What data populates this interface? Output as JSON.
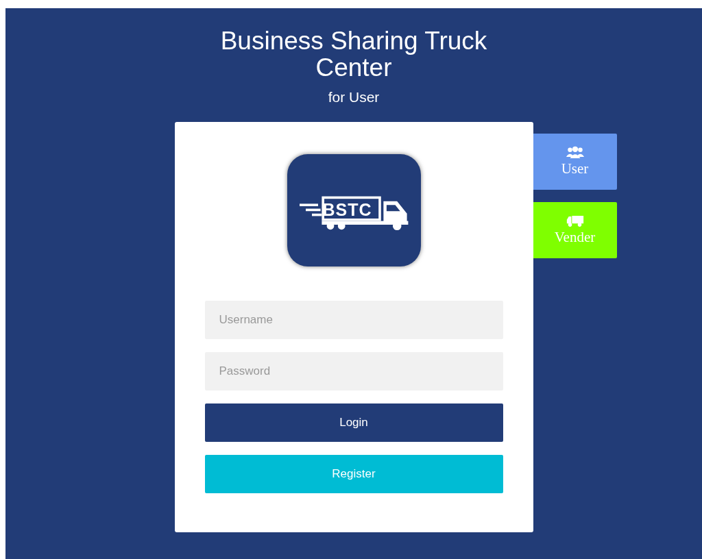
{
  "header": {
    "title": "Business Sharing Truck Center",
    "subtitle": "for User"
  },
  "logo": {
    "text": "BSTC"
  },
  "form": {
    "fields": [
      {
        "placeholder": "Username"
      },
      {
        "placeholder": "Password"
      }
    ],
    "buttons": [
      {
        "label": "Login",
        "color": "#223c77"
      },
      {
        "label": "Register",
        "color": "#00bcd4"
      }
    ]
  },
  "side_tabs": [
    {
      "label": "User",
      "kind": "users",
      "color": "#6495ed"
    },
    {
      "label": "Vender",
      "kind": "truck",
      "color": "#7fff00"
    }
  ]
}
